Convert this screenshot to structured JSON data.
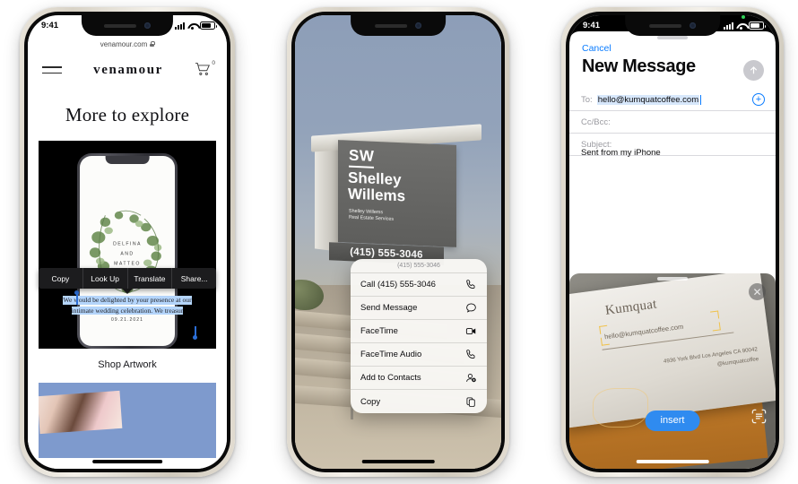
{
  "phone1": {
    "status": {
      "time": "9:41"
    },
    "browser": {
      "url": "venamour.com",
      "lock_icon": "lock-icon"
    },
    "site": {
      "menu_icon": "hamburger-menu-icon",
      "brand": "venamour",
      "cart_icon": "shopping-cart-icon",
      "cart_count": "0",
      "heading": "More to explore",
      "shop_link": "Shop Artwork"
    },
    "invitation": {
      "name_line1": "DELFINA",
      "name_line2": "AND",
      "name_line3": "MATTEO",
      "date": "09.21.2021"
    },
    "selection_menu": {
      "items": [
        {
          "label": "Copy",
          "name": "copy"
        },
        {
          "label": "Look Up",
          "name": "look-up"
        },
        {
          "label": "Translate",
          "name": "translate"
        },
        {
          "label": "Share...",
          "name": "share"
        }
      ]
    },
    "selected_text": "We would be delighted by your presence at our intimate wedding celebration. We treasur",
    "selection_color": "#b4d5fb"
  },
  "phone2": {
    "sign": {
      "initials": "SW",
      "name_line1": "Shelley",
      "name_line2": "Willems",
      "sub_line1": "Shelley Willems",
      "sub_line2": "Real Estate Services",
      "phone": "(415) 555-3046"
    },
    "context_menu": {
      "header": "(415) 555-3046",
      "items": [
        {
          "label": "Call (415) 555-3046",
          "icon": "phone-icon",
          "name": "call"
        },
        {
          "label": "Send Message",
          "icon": "message-bubble-icon",
          "name": "send-message"
        },
        {
          "label": "FaceTime",
          "icon": "video-camera-icon",
          "name": "facetime"
        },
        {
          "label": "FaceTime Audio",
          "icon": "phone-icon",
          "name": "facetime-audio"
        },
        {
          "label": "Add to Contacts",
          "icon": "person-add-icon",
          "name": "add-to-contacts"
        },
        {
          "label": "Copy",
          "icon": "copy-icon",
          "name": "copy"
        }
      ]
    }
  },
  "phone3": {
    "status": {
      "time": "9:41",
      "recording_indicator": "#30d158"
    },
    "mail": {
      "cancel_label": "Cancel",
      "title": "New Message",
      "send_icon": "send-arrow-up-icon",
      "to_label": "To:",
      "to_value": "hello@kumquatcoffee.com",
      "add_contact_icon": "plus-circle-icon",
      "ccbcc_label": "Cc/Bcc:",
      "subject_label": "Subject:",
      "body": "Sent from my iPhone"
    },
    "camera": {
      "close_icon": "close-x-icon",
      "scan_icon": "text-scanner-icon",
      "insert_label": "insert",
      "accent_color": "#2f8bf0",
      "detection_color": "#f0c24a",
      "card": {
        "brand": "Kumquat",
        "email": "hello@kumquatcoffee.com",
        "address": "4936 York Blvd Los Angeles CA 90042",
        "handle": "@kumquatcoffee"
      }
    }
  }
}
